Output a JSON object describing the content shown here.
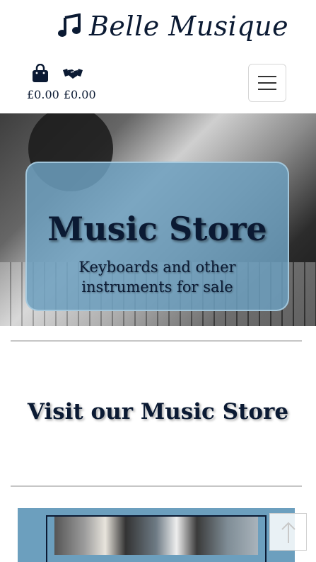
{
  "brand": {
    "name": "Belle Musique",
    "icon": "music-note-icon"
  },
  "cart": {
    "bag_icon": "shopping-bag-icon",
    "handshake_icon": "handshake-icon",
    "bag_total": "£0.00",
    "handshake_total": "£0.00"
  },
  "nav": {
    "toggle_icon": "hamburger-menu-icon"
  },
  "hero": {
    "title": "Music Store",
    "subtitle": "Keyboards and other instruments for sale"
  },
  "main": {
    "heading": "Visit our Music Store"
  },
  "back_to_top": {
    "icon": "arrow-up-icon"
  },
  "colors": {
    "primary_text": "#0b1a33",
    "accent_blue": "#6c9fbe",
    "divider": "#c6c6c6"
  }
}
